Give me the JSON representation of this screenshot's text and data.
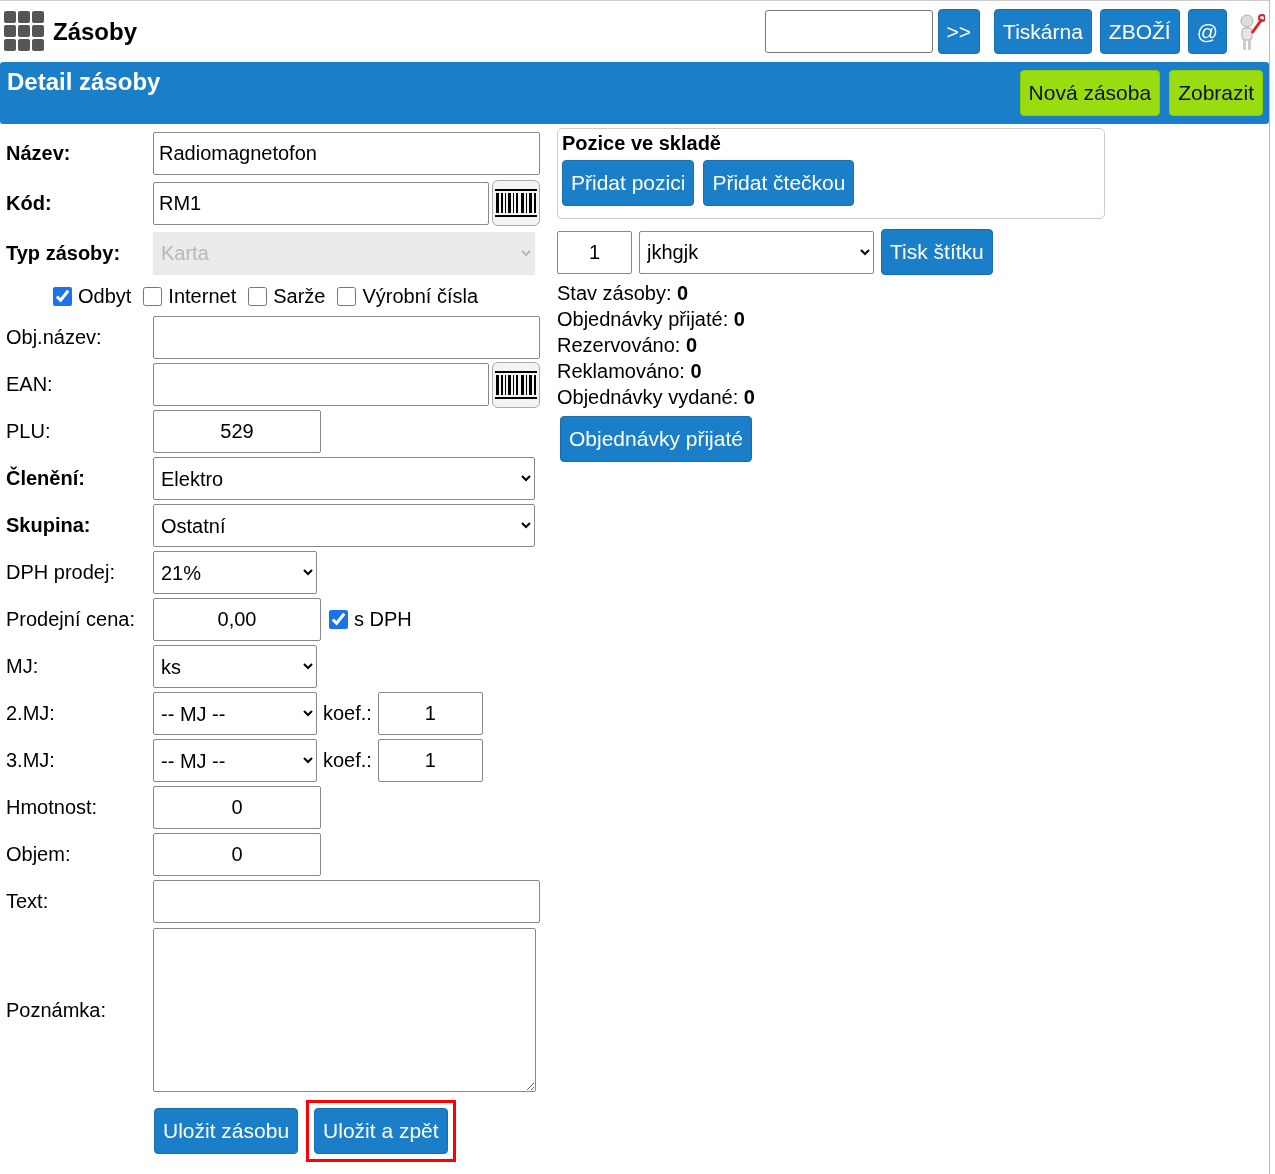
{
  "header": {
    "title": "Zásoby",
    "buttons": [
      ">>",
      "Tiskárna",
      "ZBOŽÍ",
      "@"
    ]
  },
  "banner": {
    "title": "Detail zásoby",
    "buttons": [
      "Nová zásoba",
      "Zobrazit"
    ]
  },
  "form": {
    "rows": [
      {
        "kind": "text",
        "label": "Název:",
        "bold": true,
        "value": "Radiomagnetofon"
      },
      {
        "kind": "scan",
        "label": "Kód:",
        "bold": true,
        "value": "RM1"
      },
      {
        "kind": "select",
        "label": "Typ zásoby:",
        "bold": true,
        "value": "Karta",
        "disabled": true
      },
      {
        "kind": "checks",
        "items": [
          {
            "label": "Odbyt",
            "checked": true
          },
          {
            "label": "Internet",
            "checked": false
          },
          {
            "label": "Sarže",
            "checked": false
          },
          {
            "label": "Výrobní čísla",
            "checked": false
          }
        ]
      },
      {
        "kind": "text",
        "label": "Obj.název:",
        "bold": false
      },
      {
        "kind": "scan",
        "label": "EAN:",
        "bold": false
      },
      {
        "kind": "short",
        "label": "PLU:",
        "bold": false,
        "value": "529"
      },
      {
        "kind": "select",
        "label": "Členění:",
        "bold": true,
        "value": "Elektro",
        "disabled": false
      },
      {
        "kind": "select",
        "label": "Skupina:",
        "bold": true,
        "value": "Ostatní",
        "disabled": false
      },
      {
        "kind": "select_short",
        "label": "DPH prodej:",
        "bold": false,
        "value": "21%"
      },
      {
        "kind": "price",
        "label": "Prodejní cena:",
        "bold": false,
        "value": "0,00",
        "check": {
          "label": "s DPH",
          "checked": true
        }
      },
      {
        "kind": "select_short",
        "label": "MJ:",
        "bold": false,
        "value": "ks"
      },
      {
        "kind": "unit",
        "label": "2.MJ:",
        "bold": false,
        "value": "-- MJ --",
        "koef_label": "koef.:",
        "koef": "1"
      },
      {
        "kind": "unit",
        "label": "3.MJ:",
        "bold": false,
        "value": "-- MJ --",
        "koef_label": "koef.:",
        "koef": "1"
      },
      {
        "kind": "short",
        "label": "Hmotnost:",
        "bold": false,
        "value": "0"
      },
      {
        "kind": "short",
        "label": "Objem:",
        "bold": false,
        "value": "0"
      },
      {
        "kind": "text",
        "label": "Text:",
        "bold": false
      },
      {
        "kind": "textarea",
        "label": "Poznámka:",
        "bold": false
      }
    ],
    "buttons": [
      {
        "label": "Uložit zásobu",
        "highlighted": false
      },
      {
        "label": "Uložit a zpět",
        "highlighted": true
      }
    ]
  },
  "positions": {
    "title": "Pozice ve skladě",
    "buttons": [
      "Přidat pozici",
      "Přidat čtečkou"
    ]
  },
  "label_print": {
    "quantity": "1",
    "template": "jkhgjk",
    "button": "Tisk štítku"
  },
  "stats": [
    {
      "label": "Stav zásoby:",
      "value": "0"
    },
    {
      "label": "Objednávky přijaté:",
      "value": "0"
    },
    {
      "label": "Rezervováno:",
      "value": "0"
    },
    {
      "label": "Reklamováno:",
      "value": "0"
    },
    {
      "label": "Objednávky vydané:",
      "value": "0"
    }
  ],
  "orders_button": "Objednávky přijaté"
}
